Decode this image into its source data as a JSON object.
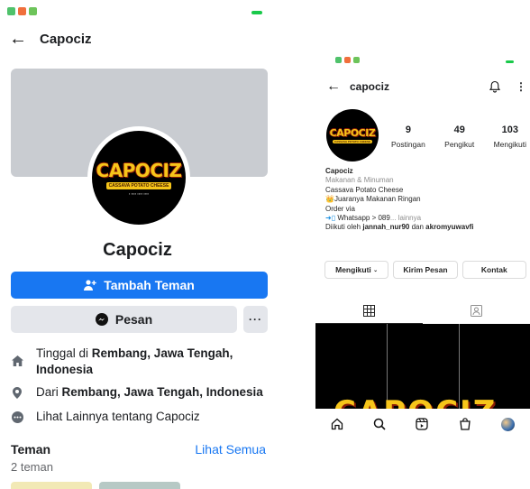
{
  "facebook": {
    "header_title": "Capociz",
    "logo_text": "CAPOCIZ",
    "logo_sub": "CASSAVA POTATO CHEESE",
    "profile_name": "Capociz",
    "add_friend_label": "Tambah Teman",
    "message_label": "Pesan",
    "more_label": "···",
    "info": {
      "lives_prefix": "Tinggal di ",
      "lives_bold": "Rembang, Jawa Tengah, Indonesia",
      "from_prefix": "Dari ",
      "from_bold": "Rembang, Jawa Tengah, Indonesia",
      "see_more": "Lihat Lainnya tentang Capociz"
    },
    "friends": {
      "title": "Teman",
      "see_all": "Lihat Semua",
      "count": "2 teman"
    },
    "colors": {
      "primary": "#1877f2",
      "secondary_btn": "#e4e6eb",
      "cover": "#c9ccd1"
    }
  },
  "instagram": {
    "username": "capociz",
    "logo_text": "CAPOCIZ",
    "logo_sub": "CASSAVA POTATO CHEESE",
    "stats": [
      {
        "value": "9",
        "label": "Postingan"
      },
      {
        "value": "49",
        "label": "Pengikut"
      },
      {
        "value": "103",
        "label": "Mengikuti"
      }
    ],
    "bio": {
      "name": "Capociz",
      "category": "Makanan & Minuman",
      "line1": "Cassava Potato Cheese",
      "line2": "Juaranya Makanan Ringan",
      "line3": "Order via",
      "line4": "Whatsapp  > 089",
      "line4_more": "... lainnya",
      "followed_prefix": "Diikuti oleh ",
      "followed_user1": "jannah_nur90",
      "followed_and": " dan ",
      "followed_user2": "akromyuwavfi"
    },
    "buttons": {
      "following": "Mengikuti",
      "message": "Kirim Pesan",
      "contact": "Kontak"
    },
    "grid_logo": "CAPOCIZ",
    "icons": {
      "tabs": [
        "grid-icon",
        "tagged-icon"
      ],
      "nav": [
        "home-icon",
        "search-icon",
        "reels-icon",
        "shop-icon",
        "profile-avatar"
      ]
    }
  }
}
